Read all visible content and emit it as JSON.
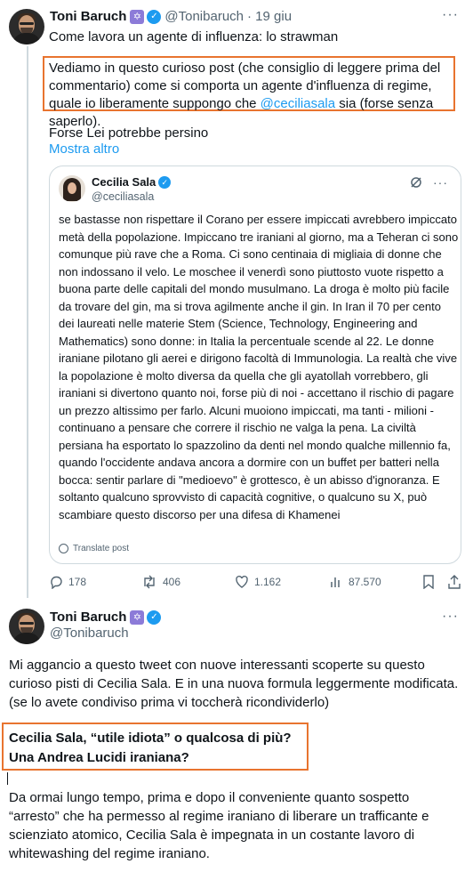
{
  "tweet1": {
    "author_name": "Toni Baruch",
    "author_handle": "@Tonibaruch",
    "timestamp": "· 19 giu",
    "title_line": "Come lavora un agente di influenza: lo strawman",
    "highlight_text_before": "Vediamo in questo curioso post (che consiglio di leggere prima del commentario) come si comporta un agente d'influenza di regime, quale io liberamente suppongo che ",
    "highlight_mention": "@ceciliasala",
    "highlight_text_after": " sia (forse senza saperlo).",
    "extra_line": "Forse Lei potrebbe persino",
    "show_more": "Mostra altro",
    "quote": {
      "author_name": "Cecilia Sala",
      "author_handle": "@ceciliasala",
      "body": "se bastasse non rispettare il Corano per essere impiccati avrebbero impiccato metà della popolazione. Impiccano tre iraniani al giorno, ma a Teheran ci sono comunque più rave che a Roma. Ci sono centinaia di migliaia di donne che non indossano il velo. Le moschee il venerdì sono piuttosto vuote rispetto a buona parte delle capitali del mondo musulmano. La droga è molto più facile da trovare del gin, ma si trova agilmente anche il gin. In Iran il 70 per cento dei laureati nelle materie Stem (Science, Technology, Engineering and Mathematics) sono donne: in Italia la percentuale scende al 22. Le donne iraniane pilotano gli aerei e dirigono facoltà di Immunologia. La realtà che vive la popolazione è molto diversa da quella che gli ayatollah vorrebbero, gli iraniani si divertono quanto noi, forse più di noi - accettano il rischio di pagare un prezzo altissimo per farlo. Alcuni muoiono impiccati, ma tanti - milioni - continuano a pensare che correre il rischio ne valga la pena. La civiltà persiana ha esportato lo spazzolino da denti nel mondo qualche millennio fa, quando l'occidente andava ancora a dormire con un buffet per batteri nella bocca: sentir parlare di \"medioevo\" è grottesco, è un abisso d'ignoranza. E soltanto qualcuno sprovvisto di capacità cognitive, o qualcuno su X, può scambiare questo discorso per una difesa di Khamenei",
      "translate_label": "Translate post"
    },
    "actions": {
      "replies": "178",
      "reposts": "406",
      "likes": "1.162",
      "views": "87.570"
    }
  },
  "tweet2": {
    "author_name": "Toni Baruch",
    "author_handle": "@Tonibaruch",
    "paragraph1": "Mi aggancio a questo tweet con nuove interessanti scoperte su questo curioso pisti di Cecilia Sala. E in una nuova formula leggermente modificata. (se lo avete condiviso prima vi toccherà ricondividerlo)",
    "heading_line1": "Cecilia Sala, “utile idiota” o qualcosa di più?",
    "heading_line2": "Una Andrea Lucidi iraniana?",
    "paragraph2": "Da ormai lungo tempo, prima e dopo il conveniente quanto sospetto “arresto” che ha permesso al regime iraniano di liberare un trafficante e scienziato atomico, Cecilia Sala è impegnata in un costante lavoro di whitewashing del regime iraniano."
  },
  "colors": {
    "highlight_border": "#e8742f",
    "link": "#1d9bf0",
    "verified": "#1d9bf0",
    "muted_text": "#536471"
  }
}
